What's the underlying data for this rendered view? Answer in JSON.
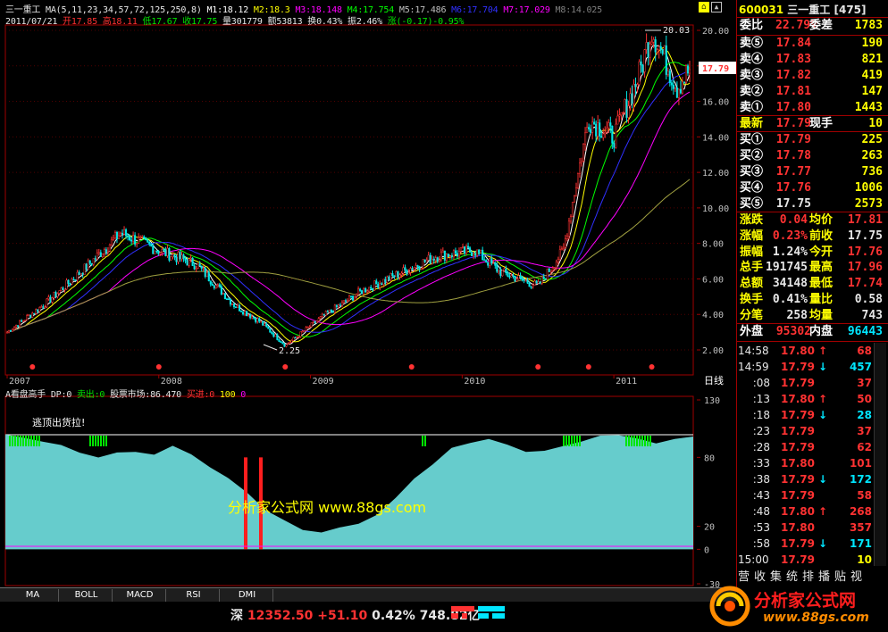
{
  "main": {
    "stock_name": "三一重工",
    "ma_params": "MA(5,11,23,34,57,72,125,250,8)",
    "ma_values": [
      {
        "label": "M1:18.12",
        "color": "#ffffff"
      },
      {
        "label": "M2:18.3",
        "color": "#ffff00"
      },
      {
        "label": "M3:18.148",
        "color": "#ff00ff"
      },
      {
        "label": "M4:17.754",
        "color": "#00ff00"
      },
      {
        "label": "M5:17.486",
        "color": "#c0c0c0"
      },
      {
        "label": "M6:17.704",
        "color": "#3030ff"
      },
      {
        "label": "M7:17.029",
        "color": "#ff00ff"
      },
      {
        "label": "M8:14.025",
        "color": "#808080"
      }
    ],
    "date": "2011/07/21",
    "open": "开17.85",
    "high": "高18.11",
    "low": "低17.67",
    "close": "收17.75",
    "volume": "量301779",
    "amount": "额53813",
    "turnover": "换0.43%",
    "amplitude": "振2.46%",
    "change": "涨(-0.17)-0.95%",
    "price_max_label": "20.03",
    "price_min_label": "2.25",
    "current_price_tag": "17.79",
    "y_ticks": [
      "20.00",
      "18.00",
      "16.00",
      "14.00",
      "12.00",
      "10.00",
      "8.00",
      "6.00",
      "4.00",
      "2.00"
    ],
    "x_years": [
      "2007",
      "2008",
      "2009",
      "2010",
      "2011"
    ],
    "period_label": "日线"
  },
  "indicator": {
    "title": "A看盘高手",
    "dp": "DP:0",
    "sell_label": "卖出:0",
    "market_label": "股票市场:86.470",
    "buy_label": "买进:0",
    "v100": "100",
    "v0": "0",
    "note": "逃顶出货拉!",
    "y_ticks": [
      "130",
      "80",
      "20",
      "0",
      "-30"
    ],
    "watermark": "分析家公式网 www.88gs.com"
  },
  "chart_data": {
    "type": "line",
    "title": "",
    "x_years": [
      "2007",
      "2008",
      "2009",
      "2010",
      "2011"
    ],
    "ylim": [
      2.0,
      20.03
    ],
    "max_price": 20.03,
    "min_price": 2.25,
    "close_series": [
      {
        "x": "2007-01",
        "y": 3.0
      },
      {
        "x": "2007-04",
        "y": 4.6
      },
      {
        "x": "2007-07",
        "y": 6.5
      },
      {
        "x": "2007-10",
        "y": 8.6
      },
      {
        "x": "2008-01",
        "y": 7.6
      },
      {
        "x": "2008-04",
        "y": 6.8
      },
      {
        "x": "2008-07",
        "y": 4.5
      },
      {
        "x": "2008-09",
        "y": 3.6
      },
      {
        "x": "2008-11",
        "y": 2.25
      },
      {
        "x": "2009-02",
        "y": 3.9
      },
      {
        "x": "2009-05",
        "y": 5.3
      },
      {
        "x": "2009-08",
        "y": 6.3
      },
      {
        "x": "2009-11",
        "y": 7.3
      },
      {
        "x": "2010-02",
        "y": 7.6
      },
      {
        "x": "2010-04",
        "y": 6.4
      },
      {
        "x": "2010-07",
        "y": 5.6
      },
      {
        "x": "2010-09",
        "y": 7.6
      },
      {
        "x": "2010-11",
        "y": 15.0
      },
      {
        "x": "2011-01",
        "y": 14.0
      },
      {
        "x": "2011-03",
        "y": 17.5
      },
      {
        "x": "2011-04",
        "y": 20.03
      },
      {
        "x": "2011-06",
        "y": 16.8
      },
      {
        "x": "2011-07",
        "y": 17.79
      }
    ],
    "indicator_ylim": [
      -30,
      130
    ],
    "indicator_series": [
      98,
      96,
      92,
      90,
      86,
      80,
      83,
      86,
      84,
      89,
      82,
      73,
      60,
      48,
      36,
      24,
      18,
      16,
      18,
      24,
      32,
      46,
      60,
      76,
      88,
      94,
      96,
      92,
      86,
      84,
      89,
      94,
      98,
      100,
      97,
      93,
      96,
      99
    ]
  },
  "quote": {
    "code": "600031",
    "name": "三一重工",
    "market_code": "[475]",
    "weibi_label": "委比",
    "weibi_value": "22.79%",
    "weicha_label": "委差",
    "weicha_value": "1783",
    "asks": [
      {
        "label": "卖⑤",
        "price": "17.84",
        "vol": "190"
      },
      {
        "label": "卖④",
        "price": "17.83",
        "vol": "821"
      },
      {
        "label": "卖③",
        "price": "17.82",
        "vol": "419"
      },
      {
        "label": "卖②",
        "price": "17.81",
        "vol": "147"
      },
      {
        "label": "卖①",
        "price": "17.80",
        "vol": "1443"
      }
    ],
    "latest_label": "最新",
    "latest_price": "17.79",
    "xianshou_label": "现手",
    "xianshou_value": "10",
    "bids": [
      {
        "label": "买①",
        "price": "17.79",
        "vol": "225"
      },
      {
        "label": "买②",
        "price": "17.78",
        "vol": "263"
      },
      {
        "label": "买③",
        "price": "17.77",
        "vol": "736"
      },
      {
        "label": "买④",
        "price": "17.76",
        "vol": "1006"
      },
      {
        "label": "买⑤",
        "price": "17.75",
        "vol": "2573"
      }
    ],
    "stats": [
      {
        "l1": "涨跌",
        "v1": "0.04",
        "c1": "red",
        "l2": "均价",
        "v2": "17.81",
        "c2": "red"
      },
      {
        "l1": "涨幅",
        "v1": "0.23%",
        "c1": "red",
        "l2": "前收",
        "v2": "17.75",
        "c2": "white"
      },
      {
        "l1": "振幅",
        "v1": "1.24%",
        "c1": "white",
        "l2": "今开",
        "v2": "17.76",
        "c2": "red"
      },
      {
        "l1": "总手",
        "v1": "191745",
        "c1": "white",
        "l2": "最高",
        "v2": "17.96",
        "c2": "red"
      },
      {
        "l1": "总额",
        "v1": "34148",
        "c1": "white",
        "l2": "最低",
        "v2": "17.74",
        "c2": "red"
      },
      {
        "l1": "换手",
        "v1": "0.41%",
        "c1": "white",
        "l2": "量比",
        "v2": "0.58",
        "c2": "white"
      },
      {
        "l1": "分笔",
        "v1": "258",
        "c1": "white",
        "l2": "均量",
        "v2": "743",
        "c2": "white"
      }
    ],
    "outer_label": "外盘",
    "outer_value": "95302",
    "inner_label": "内盘",
    "inner_value": "96443"
  },
  "ticks": [
    {
      "time": "14:58",
      "price": "17.80",
      "dir": "up",
      "vol": "68"
    },
    {
      "time": "14:59",
      "price": "17.79",
      "dir": "down",
      "vol": "457"
    },
    {
      "time": ":08",
      "price": "17.79",
      "dir": "",
      "vol": "37"
    },
    {
      "time": ":13",
      "price": "17.80",
      "dir": "up",
      "vol": "50"
    },
    {
      "time": ":18",
      "price": "17.79",
      "dir": "down",
      "vol": "28"
    },
    {
      "time": ":23",
      "price": "17.79",
      "dir": "",
      "vol": "37"
    },
    {
      "time": ":28",
      "price": "17.79",
      "dir": "",
      "vol": "62"
    },
    {
      "time": ":33",
      "price": "17.80",
      "dir": "",
      "vol": "101"
    },
    {
      "time": ":38",
      "price": "17.79",
      "dir": "down",
      "vol": "172"
    },
    {
      "time": ":43",
      "price": "17.79",
      "dir": "",
      "vol": "58"
    },
    {
      "time": ":48",
      "price": "17.80",
      "dir": "up",
      "vol": "268"
    },
    {
      "time": ":53",
      "price": "17.80",
      "dir": "",
      "vol": "357"
    },
    {
      "time": ":58",
      "price": "17.79",
      "dir": "down",
      "vol": "171"
    },
    {
      "time": "15:00",
      "price": "17.79",
      "dir": "",
      "vol": "10"
    }
  ],
  "bottom_tabs": [
    "MA",
    "BOLL",
    "MACD",
    "RSI",
    "DMI"
  ],
  "right_tabs": "营收集统排播贴视",
  "status": {
    "index_name": "深",
    "index_value": "12352.50",
    "index_change": "+51.10",
    "index_pct": "0.42%",
    "amount": "748.82亿"
  },
  "logo": {
    "text": "分析家公式网",
    "url": "www.88gs.com"
  },
  "colors": {
    "up": "#ff3232",
    "down": "#00e600",
    "label": "#ffffff",
    "volume": "#ffff00",
    "grid": "#a00000",
    "indicator_fill": "#66cccc"
  }
}
